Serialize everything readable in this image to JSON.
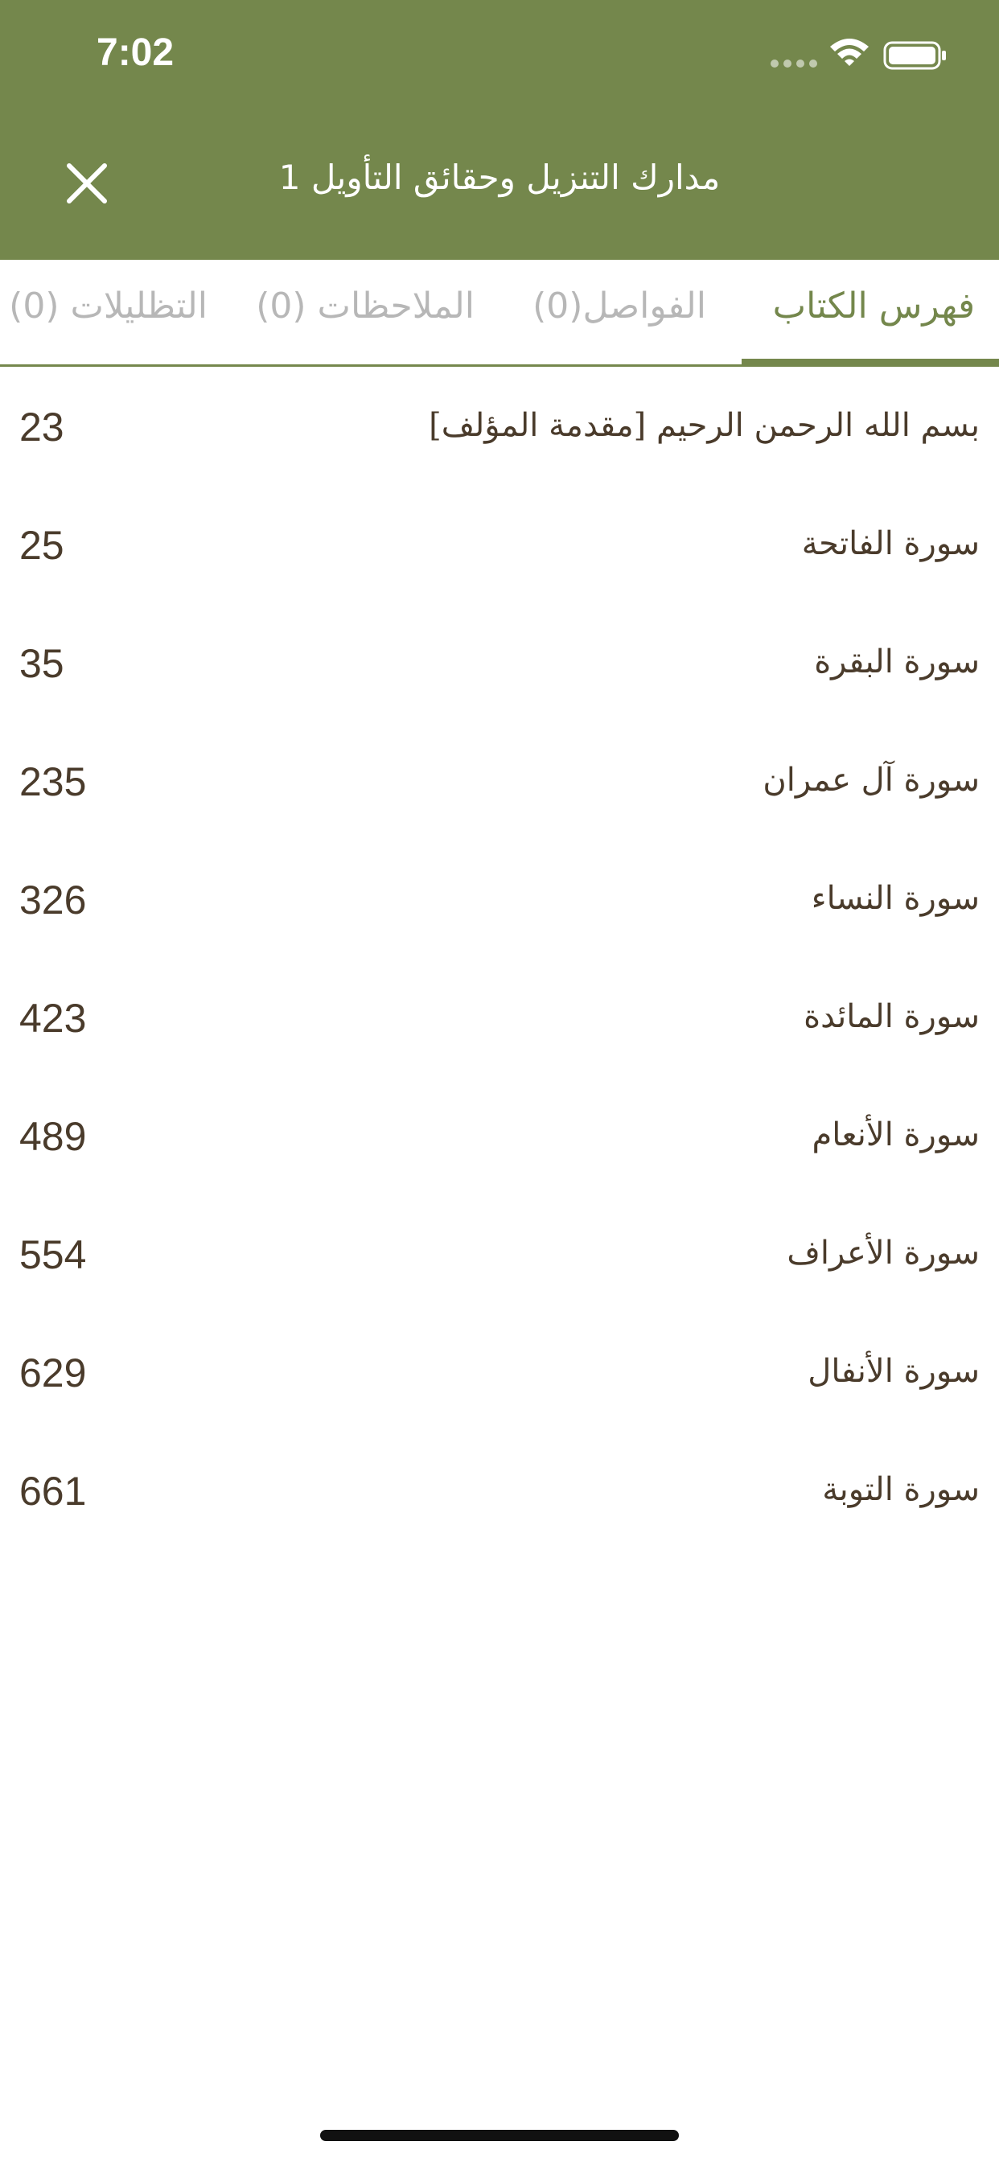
{
  "status_bar": {
    "time": "7:02",
    "icons": [
      "signal-dots-icon",
      "wifi-icon",
      "battery-icon"
    ]
  },
  "header": {
    "title": "مدارك التنزيل وحقائق التأويل 1",
    "close_icon": "close-icon"
  },
  "tabs": [
    {
      "label": "فهرس الكتاب",
      "active": true
    },
    {
      "label": "الفواصل(0)",
      "active": false
    },
    {
      "label": "الملاحظات (0)",
      "active": false
    },
    {
      "label": "التظليلات (0)",
      "active": false
    }
  ],
  "toc": [
    {
      "label": "بسم الله الرحمن الرحيم [مقدمة المؤلف]",
      "page": "23"
    },
    {
      "label": "سورة الفاتحة",
      "page": "25"
    },
    {
      "label": "سورة البقرة",
      "page": "35"
    },
    {
      "label": "سورة آل عمران",
      "page": "235"
    },
    {
      "label": "سورة النساء",
      "page": "326"
    },
    {
      "label": "سورة المائدة",
      "page": "423"
    },
    {
      "label": "سورة الأنعام",
      "page": "489"
    },
    {
      "label": "سورة الأعراف",
      "page": "554"
    },
    {
      "label": "سورة الأنفال",
      "page": "629"
    },
    {
      "label": "سورة التوبة",
      "page": "661"
    }
  ],
  "colors": {
    "accent": "#74874c",
    "text": "#4a3b2b",
    "inactive_tab": "#b7b7b7"
  }
}
